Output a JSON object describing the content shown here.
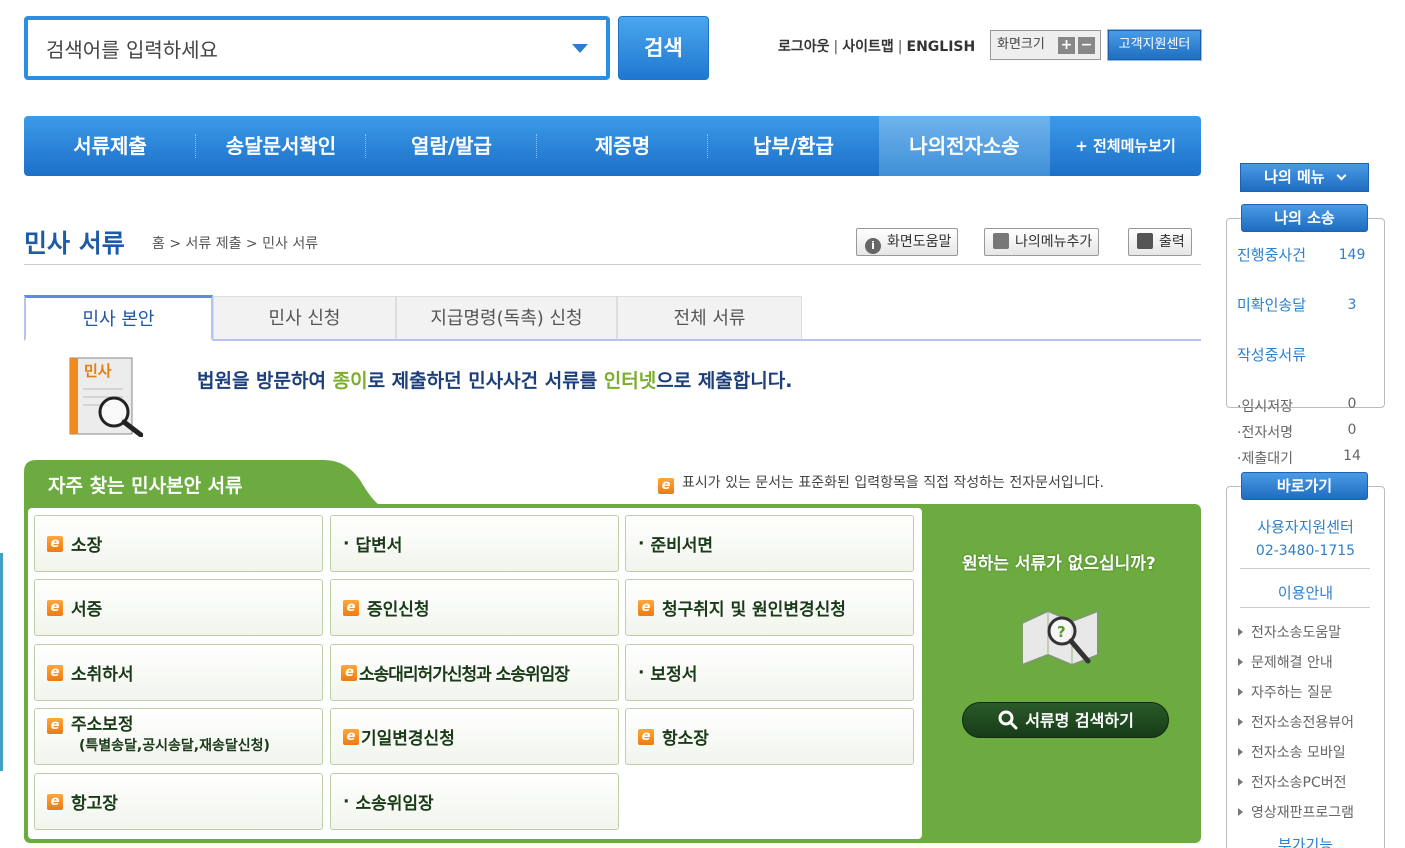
{
  "search": {
    "placeholder": "검색어를 입력하세요",
    "button_label": "검색"
  },
  "util_links": {
    "logout": "로그아웃",
    "sitemap": "사이트맵",
    "english": "ENGLISH",
    "sep": "|",
    "font_size_label": "화면크기",
    "plus": "+",
    "minus": "−",
    "support_center": "고객지원센터"
  },
  "gnb": {
    "items": [
      {
        "label": "서류제출"
      },
      {
        "label": "송달문서확인"
      },
      {
        "label": "열람/발급"
      },
      {
        "label": "제증명"
      },
      {
        "label": "납부/환급"
      },
      {
        "label": "나의전자소송"
      }
    ],
    "all_menu": "+ 전체메뉴보기"
  },
  "page": {
    "title": "민사 서류",
    "breadcrumb": "홈 > 서류 제출 > 민사 서류",
    "tools": {
      "help": "화면도움말",
      "add_menu": "나의메뉴추가",
      "print": "출력"
    }
  },
  "tabs": [
    {
      "label": "민사 본안"
    },
    {
      "label": "민사 신청"
    },
    {
      "label": "지급명령(독촉) 신청"
    },
    {
      "label": "전체 서류"
    }
  ],
  "intro": {
    "icon_label": "민사",
    "part1": "법원을 방문하여 ",
    "paper": "종이",
    "part2": "로 제출하던 민사사건 서류를 ",
    "internet": "인터넷",
    "part3": "으로 제출합니다."
  },
  "frequent": {
    "title": "자주 찾는 민사본안 서류",
    "note": "표시가 있는 문서는 표준화된 입력항목을 직접 작성하는 전자문서입니다.",
    "docs": [
      {
        "label": "소장",
        "electronic": true
      },
      {
        "label": "답변서",
        "electronic": false
      },
      {
        "label": "준비서면",
        "electronic": false
      },
      {
        "label": "서증",
        "electronic": true
      },
      {
        "label": "증인신청",
        "electronic": true
      },
      {
        "label": "청구취지 및 원인변경신청",
        "electronic": true
      },
      {
        "label": "소취하서",
        "electronic": true
      },
      {
        "label": "소송대리허가신청과 소송위임장",
        "electronic": true
      },
      {
        "label": "보정서",
        "electronic": false
      },
      {
        "label": "주소보정",
        "sub": "(특별송달,공시송달,재송달신청)",
        "electronic": true
      },
      {
        "label": "기일변경신청",
        "electronic": true
      },
      {
        "label": "항소장",
        "electronic": true
      },
      {
        "label": "항고장",
        "electronic": true
      },
      {
        "label": "소송위임장",
        "electronic": false
      }
    ],
    "no_doc_text": "원하는 서류가 없으십니까?",
    "search_button": "서류명 검색하기"
  },
  "sidebar": {
    "my_menu": "나의 메뉴",
    "my_litigation": {
      "title": "나의 소송",
      "rows": [
        {
          "label": "진행중사건",
          "count": "149"
        },
        {
          "label": "미확인송달",
          "count": "3"
        },
        {
          "label": "작성중서류",
          "count": ""
        }
      ],
      "drafts": [
        {
          "label": "·임시저장",
          "count": "0"
        },
        {
          "label": "·전자서명",
          "count": "0"
        },
        {
          "label": "·제출대기",
          "count": "14"
        }
      ]
    },
    "shortcut": {
      "title": "바로가기",
      "center_name": "사용자지원센터",
      "center_phone": "02-3480-1715",
      "guide_title": "이용안내",
      "guide_items": [
        "전자소송도움말",
        "문제해결 안내",
        "자주하는 질문",
        "전자소송전용뷰어",
        "전자소송 모바일",
        "전자소송PC버전",
        "영상재판프로그램"
      ],
      "more_title": "부가기능"
    }
  },
  "colors": {
    "primary_blue": "#1c70c8",
    "panel_green": "#6cab3f",
    "title_blue": "#1d5aa8",
    "accent_green": "#7cae2d",
    "e_doc_orange": "#ee7a10"
  },
  "icons": [
    "dropdown-caret-icon",
    "info-icon",
    "add-menu-icon",
    "print-icon",
    "civil-doc-magnifier-icon",
    "e-document-icon",
    "magnifier-icon",
    "map-search-icon",
    "chevron-down-icon",
    "arrow-right-icon"
  ]
}
